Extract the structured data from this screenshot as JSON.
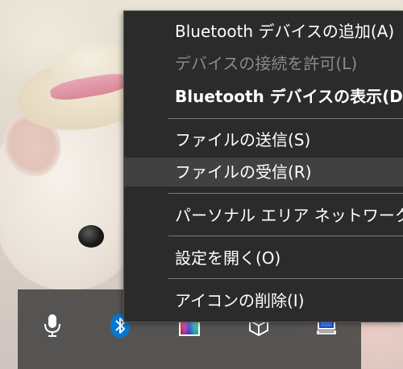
{
  "context_menu": {
    "items": [
      {
        "label": "Bluetooth デバイスの追加(A)",
        "enabled": true,
        "bold": false,
        "highlighted": false
      },
      {
        "label": "デバイスの接続を許可(L)",
        "enabled": false,
        "bold": false,
        "highlighted": false
      },
      {
        "label": "Bluetooth デバイスの表示(D)",
        "enabled": true,
        "bold": true,
        "highlighted": false
      },
      {
        "label": "ファイルの送信(S)",
        "enabled": true,
        "bold": false,
        "highlighted": false
      },
      {
        "label": "ファイルの受信(R)",
        "enabled": true,
        "bold": false,
        "highlighted": true
      },
      {
        "label": "パーソナル エリア ネットワークへ参加(J)",
        "enabled": true,
        "bold": false,
        "highlighted": false
      },
      {
        "label": "設定を開く(O)",
        "enabled": true,
        "bold": false,
        "highlighted": false
      },
      {
        "label": "アイコンの削除(I)",
        "enabled": true,
        "bold": false,
        "highlighted": false
      }
    ]
  },
  "tray": {
    "icons": [
      "microphone-icon",
      "bluetooth-icon",
      "color-picker-icon",
      "unity-icon",
      "network-pc-icon"
    ]
  },
  "colors": {
    "menu_background": "#2b2b2b",
    "menu_text": "#ffffff",
    "menu_text_disabled": "#8a8a8a",
    "menu_highlight": "#414141",
    "bluetooth_blue": "#0078d7"
  }
}
